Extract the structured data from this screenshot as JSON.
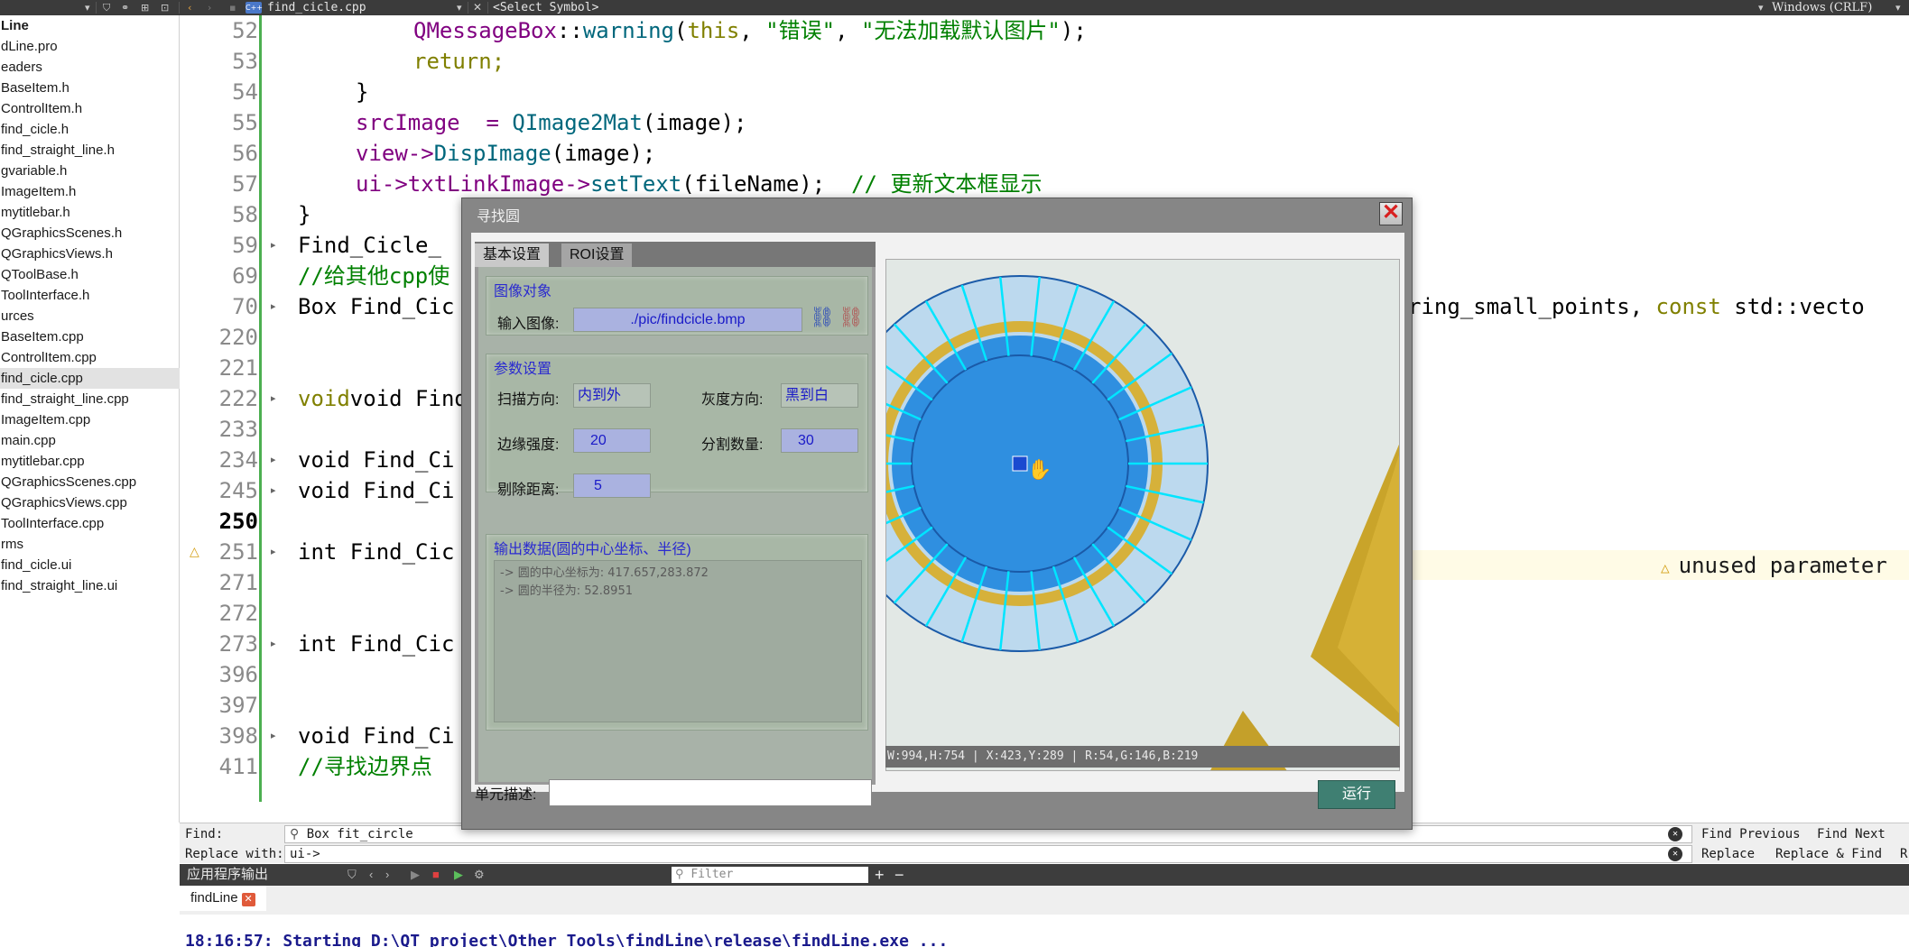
{
  "topbar": {
    "file_name": "find_cicle.cpp",
    "symbol": "<Select Symbol>",
    "encoding": "Windows (CRLF)",
    "file_icon_text": "C++"
  },
  "project_tree": [
    {
      "label": "Line",
      "bold": true
    },
    {
      "label": "dLine.pro"
    },
    {
      "label": "eaders"
    },
    {
      "label": "BaseItem.h"
    },
    {
      "label": "ControlItem.h"
    },
    {
      "label": "find_cicle.h"
    },
    {
      "label": "find_straight_line.h"
    },
    {
      "label": "gvariable.h"
    },
    {
      "label": "ImageItem.h"
    },
    {
      "label": "mytitlebar.h"
    },
    {
      "label": "QGraphicsScenes.h"
    },
    {
      "label": "QGraphicsViews.h"
    },
    {
      "label": "QToolBase.h"
    },
    {
      "label": "ToolInterface.h"
    },
    {
      "label": "urces"
    },
    {
      "label": "BaseItem.cpp"
    },
    {
      "label": "ControlItem.cpp"
    },
    {
      "label": "find_cicle.cpp",
      "selected": true
    },
    {
      "label": "find_straight_line.cpp"
    },
    {
      "label": "ImageItem.cpp"
    },
    {
      "label": "main.cpp"
    },
    {
      "label": "mytitlebar.cpp"
    },
    {
      "label": "QGraphicsScenes.cpp"
    },
    {
      "label": "QGraphicsViews.cpp"
    },
    {
      "label": "ToolInterface.cpp"
    },
    {
      "label": "rms"
    },
    {
      "label": "find_cicle.ui"
    },
    {
      "label": "find_straight_line.ui"
    }
  ],
  "editor": {
    "lines": [
      {
        "num": "52"
      },
      {
        "num": "53"
      },
      {
        "num": "54"
      },
      {
        "num": "55"
      },
      {
        "num": "56"
      },
      {
        "num": "57"
      },
      {
        "num": "58"
      },
      {
        "num": "59",
        "fold": true
      },
      {
        "num": "69"
      },
      {
        "num": "70",
        "fold": true
      },
      {
        "num": "220"
      },
      {
        "num": "221"
      },
      {
        "num": "222",
        "fold": true
      },
      {
        "num": "233"
      },
      {
        "num": "234",
        "fold": true
      },
      {
        "num": "245",
        "fold": true
      },
      {
        "num": "250",
        "current": true
      },
      {
        "num": "251",
        "fold": true,
        "warning": true
      },
      {
        "num": "271"
      },
      {
        "num": "272"
      },
      {
        "num": "273",
        "fold": true
      },
      {
        "num": "396"
      },
      {
        "num": "397"
      },
      {
        "num": "398",
        "fold": true
      },
      {
        "num": "411"
      }
    ],
    "code": {
      "l52_a": "QMessageBox",
      "l52_b": "::",
      "l52_c": "warning",
      "l52_d": "(",
      "l52_e": "this",
      "l52_f": ", ",
      "l52_g": "\"错误\"",
      "l52_h": ", ",
      "l52_i": "\"无法加载默认图片\"",
      "l52_j": ");",
      "l53": "return;",
      "l54": "}",
      "l55_a": "srcImage  = ",
      "l55_b": "QImage2Mat",
      "l55_c": "(image);",
      "l56_a": "view->",
      "l56_b": "DispImage",
      "l56_c": "(image);",
      "l57_a": "ui->txtLinkImage->",
      "l57_b": "setText",
      "l57_c": "(fileName);  ",
      "l57_d": "// 更新文本框显示",
      "l58": "}",
      "l59": "Find_Cicle_",
      "l69": "//给其他cpp使",
      "l70_a": "Box Find_Cic",
      "l70_b": "ring_small_points, ",
      "l70_c": "const ",
      "l70_d": "std::vecto",
      "l222": "void Find_Ci",
      "l234": "void Find_Ci",
      "l245": "void Find_Ci",
      "l251": "int Find_Cic",
      "l273": "int Find_Cic",
      "l398": "void Find_Ci",
      "l411": "//寻找边界点"
    },
    "warning_text": "unused parameter"
  },
  "findbar": {
    "find_label": "Find:",
    "find_value": "Box fit_circle",
    "replace_label": "Replace with:",
    "replace_value": "ui->",
    "find_previous": "Find Previous",
    "find_next": "Find Next",
    "replace": "Replace",
    "replace_find": "Replace & Find",
    "replace_all_partial": "R"
  },
  "output": {
    "title": "应用程序输出",
    "filter_placeholder": "Filter",
    "tab_label": "findLine",
    "text": "18:16:57: Starting D:\\QT_project\\Other_Tools\\findLine\\release\\findLine.exe ..."
  },
  "dialog": {
    "title": "寻找圆",
    "tabs": [
      "基本设置",
      "ROI设置"
    ],
    "image_group": {
      "title": "图像对象",
      "input_label": "输入图像:",
      "input_value": "./pic/findcicle.bmp"
    },
    "param_group": {
      "title": "参数设置",
      "scan_dir_label": "扫描方向:",
      "scan_dir_value": "内到外",
      "gray_dir_label": "灰度方向:",
      "gray_dir_value": "黑到白",
      "edge_strength_label": "边缘强度:",
      "edge_strength_value": "20",
      "split_count_label": "分割数量:",
      "split_count_value": "30",
      "remove_dist_label": "剔除距离:",
      "remove_dist_value": "5"
    },
    "output_group": {
      "title": "输出数据(圆的中心坐标、半径)",
      "line1": "-> 圆的中心坐标为: 417.657,283.872",
      "line2": "-> 圆的半径为: 52.8951"
    },
    "desc_label": "单元描述:",
    "desc_value": "",
    "run_label": "运行",
    "image_status": "W:994,H:754 | X:423,Y:289 | R:54,G:146,B:219",
    "colors": {
      "circle_fill": "#2f8fe0",
      "ring_fill": "#bcd9ee",
      "edge_gold": "#d6b13a",
      "scan_lines": "#00e5ff",
      "background_triangle": "#c9a42a"
    }
  }
}
